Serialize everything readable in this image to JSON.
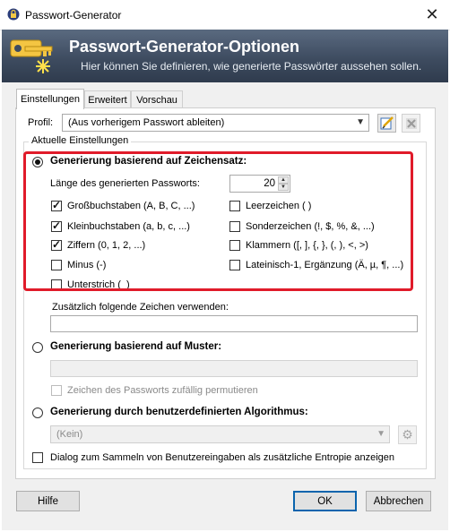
{
  "window": {
    "title": "Passwort-Generator"
  },
  "banner": {
    "title": "Passwort-Generator-Optionen",
    "subtitle": "Hier können Sie definieren, wie generierte Passwörter aussehen sollen."
  },
  "tabs": [
    {
      "label": "Einstellungen",
      "active": true
    },
    {
      "label": "Erweitert",
      "active": false
    },
    {
      "label": "Vorschau",
      "active": false
    }
  ],
  "profile": {
    "label": "Profil:",
    "value": "(Aus vorherigem Passwort ableiten)"
  },
  "group": {
    "legend": "Aktuelle Einstellungen"
  },
  "charset": {
    "radio_label": "Generierung basierend auf Zeichensatz:",
    "length_label": "Länge des generierten Passworts:",
    "length_value": "20",
    "options": [
      {
        "label": "Großbuchstaben (A, B, C, ...)",
        "checked": true
      },
      {
        "label": "Kleinbuchstaben (a, b, c, ...)",
        "checked": true
      },
      {
        "label": "Ziffern (0, 1, 2, ...)",
        "checked": true
      },
      {
        "label": "Minus (-)",
        "checked": false
      },
      {
        "label": "Unterstrich (_)",
        "checked": false
      },
      {
        "label": "Leerzeichen ( )",
        "checked": false
      },
      {
        "label": "Sonderzeichen (!, $, %, &, ...)",
        "checked": false
      },
      {
        "label": "Klammern ([, ], {, }, (, ), <, >)",
        "checked": false
      },
      {
        "label": "Lateinisch-1, Ergänzung (Ä, µ, ¶, ...)",
        "checked": false
      }
    ],
    "additional_label": "Zusätzlich folgende Zeichen verwenden:",
    "additional_value": ""
  },
  "pattern": {
    "radio_label": "Generierung basierend auf Muster:",
    "value": "",
    "permute_label": "Zeichen des Passworts zufällig permutieren"
  },
  "custom": {
    "radio_label": "Generierung durch benutzerdefinierten Algorithmus:",
    "value": "(Kein)"
  },
  "entropy": {
    "label": "Dialog zum Sammeln von Benutzereingaben als zusätzliche Entropie anzeigen"
  },
  "buttons": {
    "help": "Hilfe",
    "ok": "OK",
    "cancel": "Abbrechen"
  },
  "colors": {
    "highlight": "#e01b2a",
    "banner": "#3e4c60",
    "default_button_border": "#0a64ad"
  },
  "icons": {
    "app": "lock-icon",
    "banner": "key-icon",
    "close": "close-icon",
    "edit_profile": "edit-icon",
    "delete_profile": "delete-icon",
    "algorithm_settings": "gear-icon"
  }
}
